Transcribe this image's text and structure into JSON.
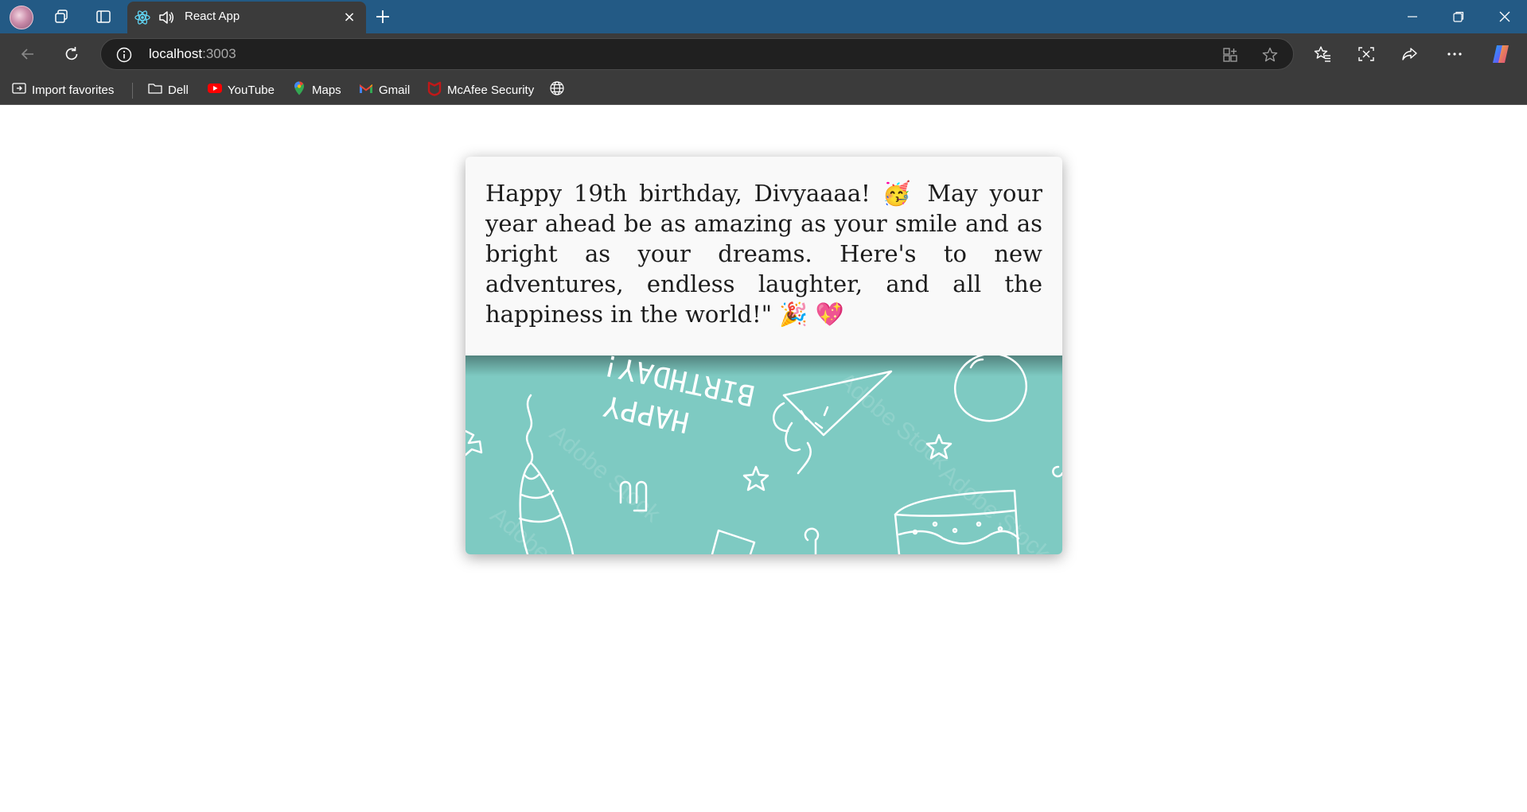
{
  "browser": {
    "tab": {
      "title": "React App",
      "close_glyph": "×"
    },
    "new_tab_glyph": "+",
    "address": {
      "host": "localhost",
      "port": ":3003"
    },
    "bookmarks": [
      {
        "label": "Import favorites",
        "icon": "import-icon"
      },
      {
        "label": "Dell",
        "icon": "folder-icon"
      },
      {
        "label": "YouTube",
        "icon": "youtube-icon"
      },
      {
        "label": "Maps",
        "icon": "maps-icon"
      },
      {
        "label": "Gmail",
        "icon": "gmail-icon"
      },
      {
        "label": "McAfee Security",
        "icon": "mcafee-icon"
      }
    ],
    "colors": {
      "titlebar": "#235a85",
      "toolbar": "#3b3b3b",
      "omnibox": "#202020"
    }
  },
  "page": {
    "message": "Happy 19th birthday, Divyaaaa! 🥳 May your year ahead be as amazing as your smile and as bright as your dreams. Here's to new adventures, endless laughter, and all the happiness in the world!\" 🎉 💖",
    "image": {
      "heading_top": "BIRTHDAY!",
      "heading_bottom": "HAPPY",
      "watermark": "Adobe Stock",
      "background_color": "#7ecac2"
    }
  }
}
